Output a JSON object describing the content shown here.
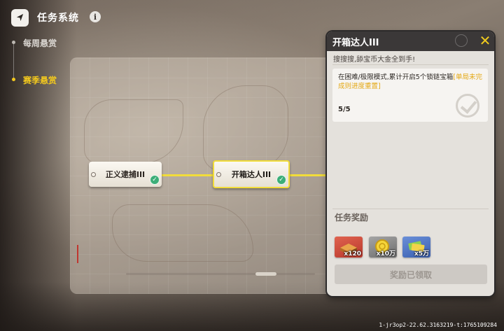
{
  "header": {
    "title": "任务系统",
    "info_glyph": "i"
  },
  "tabs": [
    {
      "label": "每周悬赏",
      "active": false
    },
    {
      "label": "赛季悬赏",
      "active": true
    }
  ],
  "colors": {
    "accent": "#f1dc3a",
    "tab_active": "#f2c81e",
    "complete": "#3cae78",
    "reward_highlight": "#e4a814"
  },
  "quest_chain": [
    {
      "label": "正义逮捕III",
      "completed": true,
      "selected": false
    },
    {
      "label": "开箱达人III",
      "completed": true,
      "selected": true
    }
  ],
  "detail": {
    "title": "开箱达人III",
    "subtitle": "搜搜搜,舔宝币大金全到手!",
    "description": "在困难/极限模式,累计开启5个锁链宝箱",
    "description_note": "[单局未完成则进度重置]",
    "progress": "5/5",
    "rewards_title": "任务奖励",
    "rewards": [
      {
        "icon": "gold-bar-chest-icon",
        "qty": "x120"
      },
      {
        "icon": "gold-coin-icon",
        "qty": "x10万"
      },
      {
        "icon": "cash-bundle-icon",
        "qty": "x5万"
      }
    ],
    "claim_label": "奖励已领取"
  },
  "footer": {
    "build_id": "1-jr3op2-22.62.3163219-t:1765109284"
  }
}
